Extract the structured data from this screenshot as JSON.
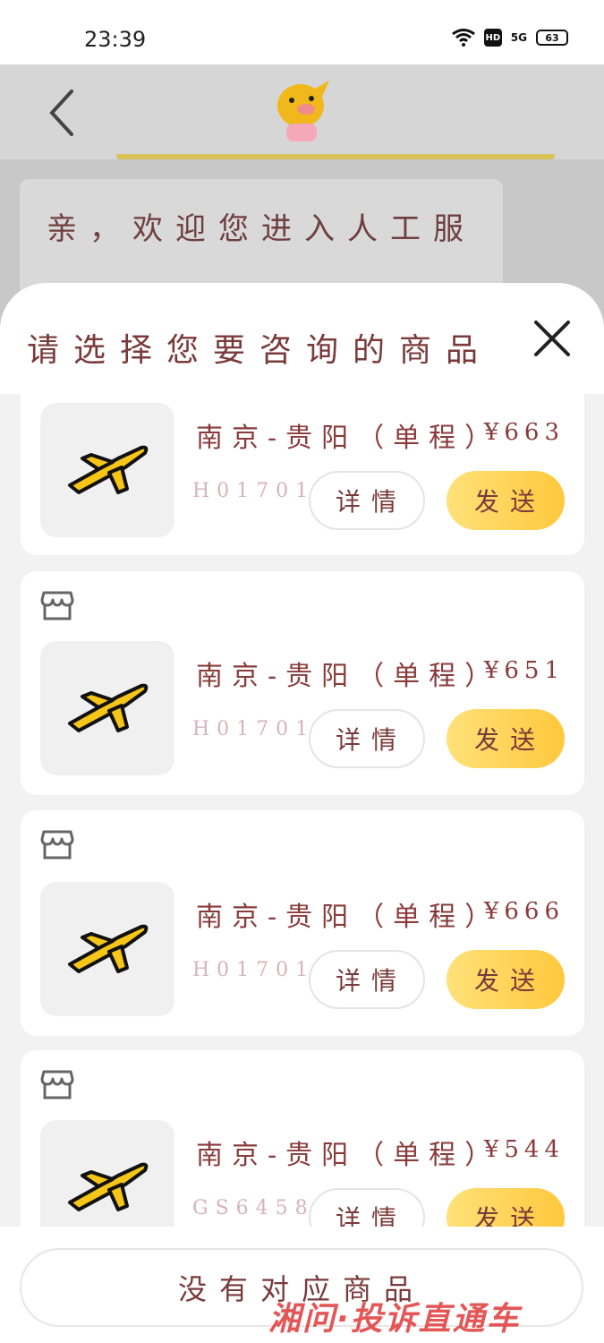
{
  "status_bar": {
    "time": "23:39",
    "network": "5G",
    "hd_badge": "HD",
    "battery": "63"
  },
  "chat": {
    "greeting": "亲，欢迎您进入人工服"
  },
  "sheet": {
    "title": "请选择您要咨询的商品",
    "items": [
      {
        "route": "南京-贵阳（单程）",
        "price": "¥663",
        "code": "H01701",
        "detail_label": "详情",
        "send_label": "发送"
      },
      {
        "route": "南京-贵阳（单程）",
        "price": "¥651",
        "code": "H01701",
        "detail_label": "详情",
        "send_label": "发送"
      },
      {
        "route": "南京-贵阳（单程）",
        "price": "¥666",
        "code": "H01701",
        "detail_label": "详情",
        "send_label": "发送"
      },
      {
        "route": "南京-贵阳（单程）",
        "price": "¥544",
        "code": "GS6458",
        "detail_label": "详情",
        "send_label": "发送"
      }
    ],
    "no_match_label": "没有对应商品"
  },
  "watermark": "湘问·投诉直通车",
  "colors": {
    "accent": "#ffc83d",
    "text": "#7a3a3a",
    "plane": "#f5c518"
  }
}
